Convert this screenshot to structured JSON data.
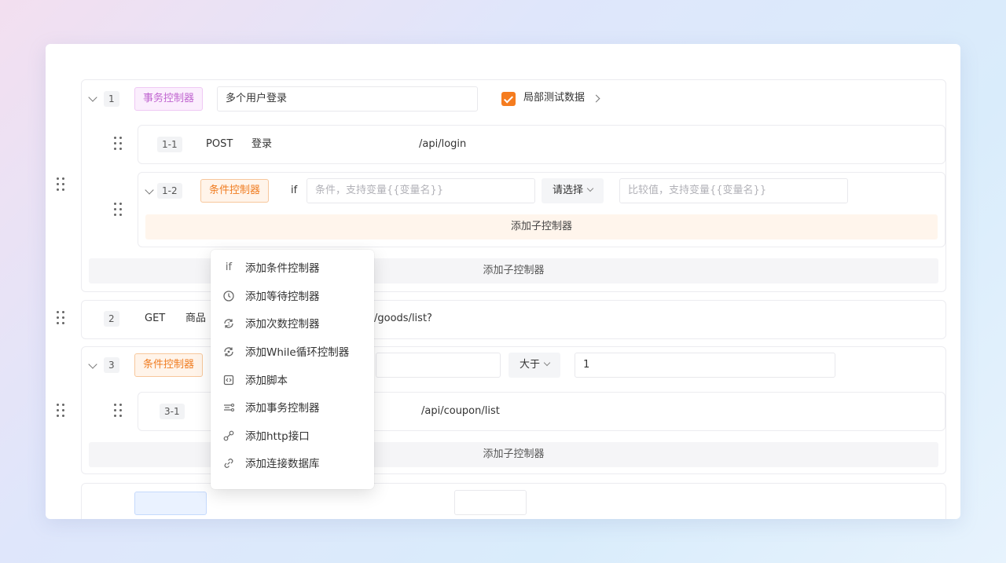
{
  "steps": {
    "s1": {
      "num": "1",
      "type": "事务控制器",
      "name": "多个用户登录",
      "local_data_label": "局部测试数据",
      "children": {
        "c11": {
          "num": "1-1",
          "method": "POST",
          "name": "登录",
          "path": "/api/login"
        },
        "c12": {
          "num": "1-2",
          "type": "条件控制器",
          "if_label": "if",
          "condition_placeholder": "条件，支持变量{{变量名}}",
          "operator": "请选择",
          "compare_placeholder": "比较值，支持变量{{变量名}}",
          "add_child": "添加子控制器"
        }
      },
      "add_child": "添加子控制器"
    },
    "s2": {
      "num": "2",
      "method": "GET",
      "name": "商品",
      "path": "/goods/list?"
    },
    "s3": {
      "num": "3",
      "type": "条件控制器",
      "operator": "大于",
      "compare_value": "1",
      "children": {
        "c31": {
          "num": "3-1",
          "path": "/api/coupon/list"
        }
      },
      "add_child": "添加子控制器"
    }
  },
  "menu": {
    "items": [
      {
        "icon": "if-icon",
        "label": "添加条件控制器"
      },
      {
        "icon": "clock-icon",
        "label": "添加等待控制器"
      },
      {
        "icon": "repeat-count-icon",
        "label": "添加次数控制器"
      },
      {
        "icon": "loop-icon",
        "label": "添加While循环控制器"
      },
      {
        "icon": "code-icon",
        "label": "添加脚本"
      },
      {
        "icon": "transaction-icon",
        "label": "添加事务控制器"
      },
      {
        "icon": "api-link-icon",
        "label": "添加http接口"
      },
      {
        "icon": "database-link-icon",
        "label": "添加连接数据库"
      }
    ],
    "if_glyph": "if"
  },
  "colors": {
    "accent_orange": "#f57c1f",
    "transaction_purple": "#c066d0"
  }
}
